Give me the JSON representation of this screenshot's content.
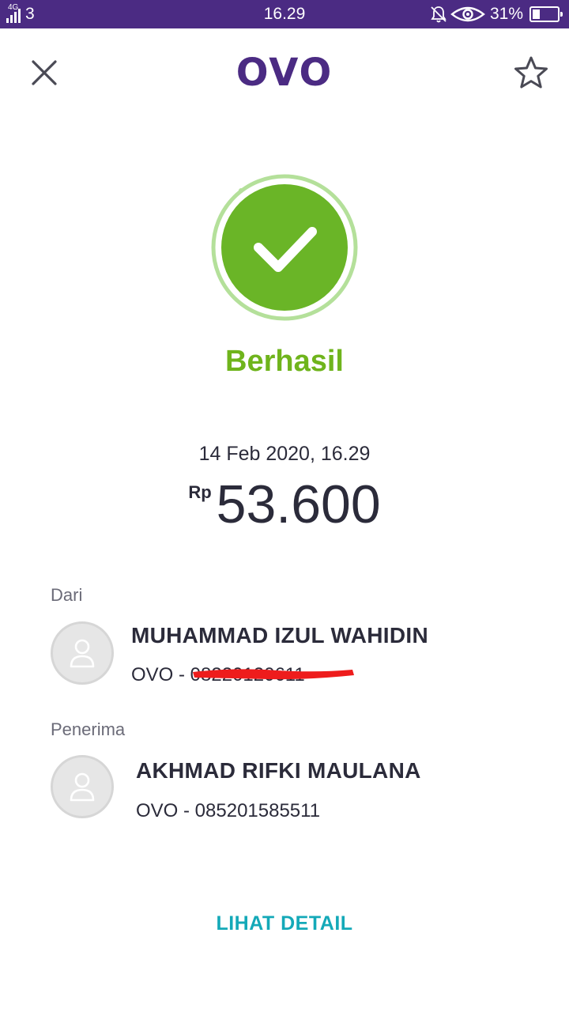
{
  "statusbar": {
    "network_type": "4G",
    "carrier": "3",
    "time": "16.29",
    "battery_percent": "31%",
    "battery_level": 0.31
  },
  "header": {
    "logo": "OVO"
  },
  "transaction": {
    "status": "Berhasil",
    "datetime": "14 Feb 2020, 16.29",
    "currency": "Rp",
    "amount": "53.600"
  },
  "sender": {
    "label": "Dari",
    "name": "MUHAMMAD IZUL WAHIDIN",
    "account_prefix": "OVO - ",
    "account": "08220120611"
  },
  "recipient": {
    "label": "Penerima",
    "name": "AKHMAD RIFKI MAULANA",
    "account": "OVO - 085201585511"
  },
  "actions": {
    "detail_label": "LIHAT DETAIL"
  },
  "colors": {
    "brand": "#4b2b83",
    "success": "#6fb41c",
    "link": "#14a9b8",
    "redaction": "#ee1c1c"
  }
}
